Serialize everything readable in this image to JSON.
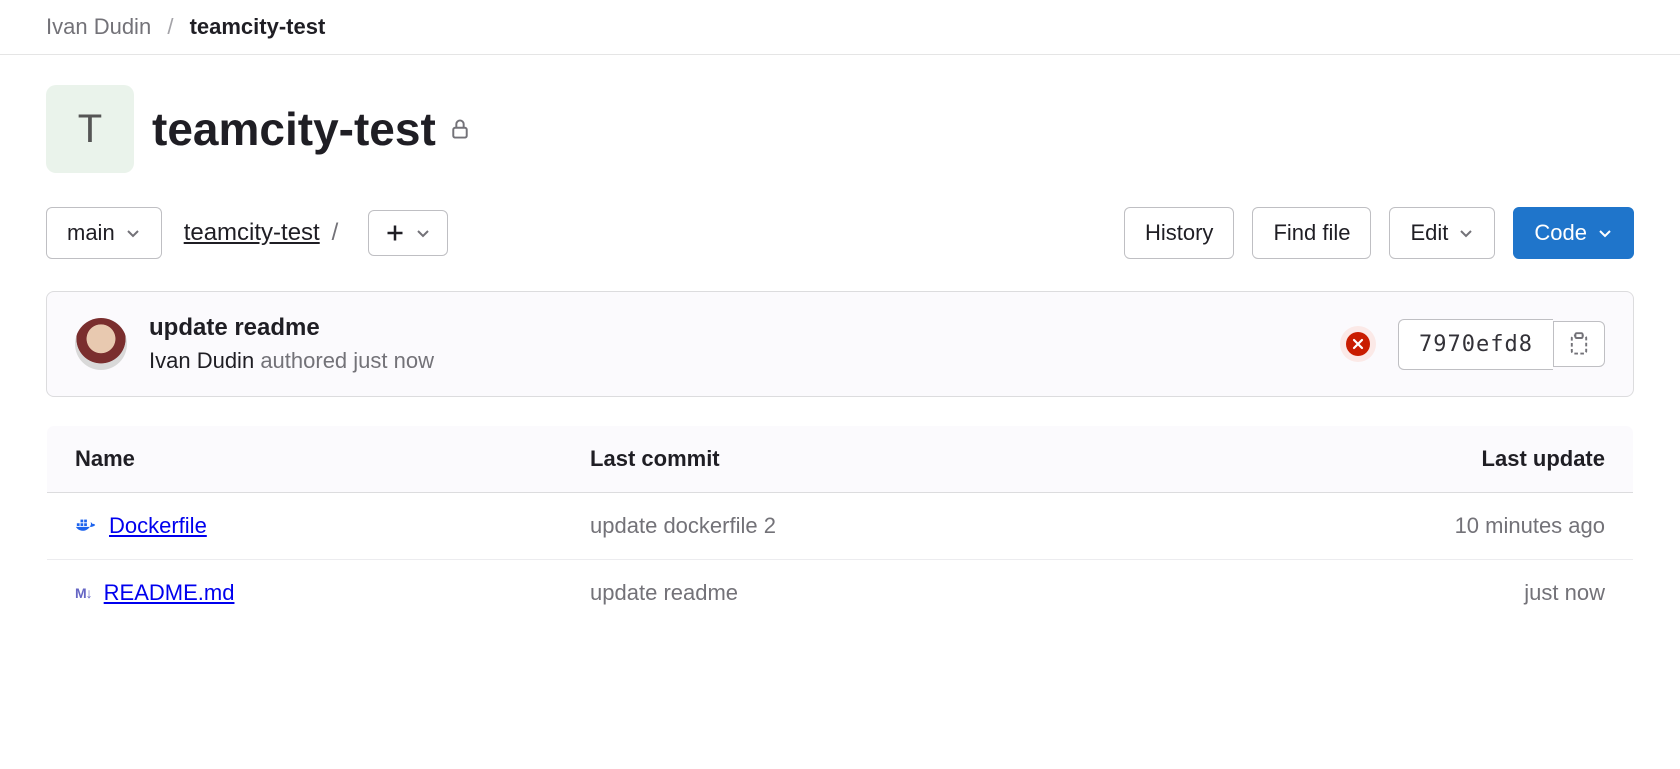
{
  "breadcrumb": {
    "owner": "Ivan Dudin",
    "repo": "teamcity-test"
  },
  "project": {
    "avatar_letter": "T",
    "name": "teamcity-test"
  },
  "toolbar": {
    "branch": "main",
    "path_root": "teamcity-test",
    "history": "History",
    "find_file": "Find file",
    "edit": "Edit",
    "code": "Code"
  },
  "commit": {
    "message": "update readme",
    "author": "Ivan Dudin",
    "authored_prefix": "authored",
    "authored_time": "just now",
    "sha": "7970efd8"
  },
  "table": {
    "headers": {
      "name": "Name",
      "last_commit": "Last commit",
      "last_update": "Last update"
    },
    "rows": [
      {
        "icon": "docker",
        "name": "Dockerfile",
        "commit": "update dockerfile 2",
        "update": "10 minutes ago"
      },
      {
        "icon": "markdown",
        "name": "README.md",
        "commit": "update readme",
        "update": "just now"
      }
    ]
  }
}
